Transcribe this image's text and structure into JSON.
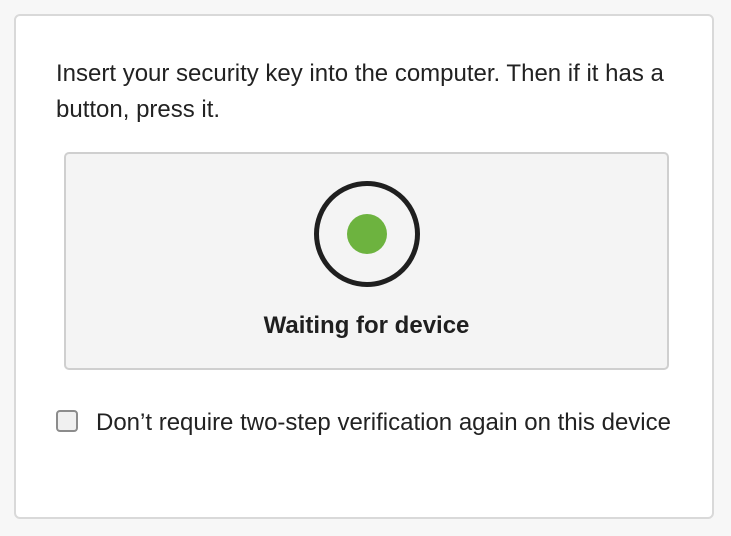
{
  "instructions": {
    "text": "Insert your security key into the computer. Then if it has a button, press it."
  },
  "device_status": {
    "label": "Waiting for device",
    "indicator_icon": "status-dot-icon",
    "indicator_color": "#6db33f"
  },
  "remember_device": {
    "checked": false,
    "label": "Don’t require two-step verification again on this device"
  }
}
